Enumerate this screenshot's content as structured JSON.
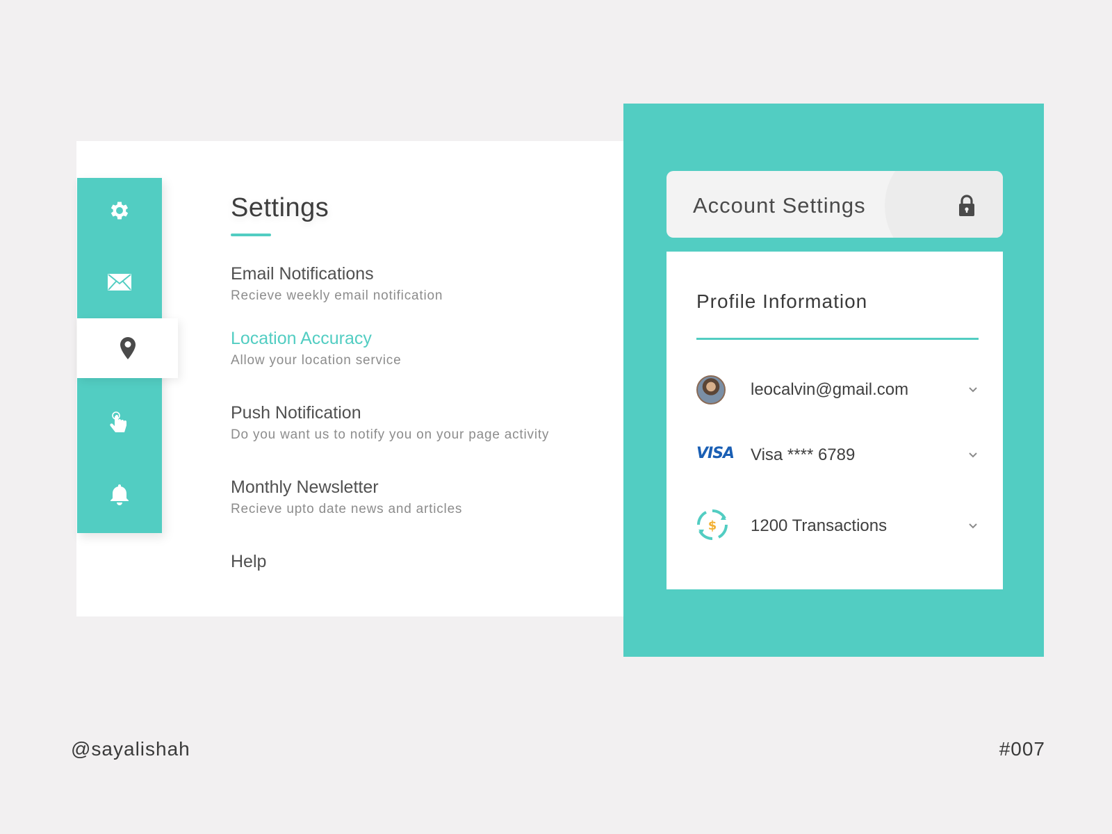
{
  "settings": {
    "title": "Settings",
    "items": [
      {
        "title": "Email Notifications",
        "subtitle": "Recieve weekly email notification"
      },
      {
        "title": "Location Accuracy",
        "subtitle": "Allow your location service"
      },
      {
        "title": "Push Notification",
        "subtitle": "Do you want us to notify you on your page activity"
      },
      {
        "title": "Monthly Newsletter",
        "subtitle": "Recieve upto date news and articles"
      },
      {
        "title": "Help"
      }
    ],
    "active_item": "Location Accuracy"
  },
  "icon_rail": {
    "items": [
      "gear-icon",
      "mail-icon",
      "location-pin-icon",
      "touch-icon",
      "bell-icon"
    ],
    "active": "location-pin-icon"
  },
  "account": {
    "title": "Account Settings",
    "profile_title": "Profile Information",
    "rows": [
      {
        "icon": "avatar",
        "text": "leocalvin@gmail.com"
      },
      {
        "icon": "visa-logo",
        "logo_text": "VISA",
        "text": "Visa **** 6789"
      },
      {
        "icon": "transactions-icon",
        "text": "1200 Transactions"
      }
    ]
  },
  "footer": {
    "handle": "@sayalishah",
    "tag": "#007"
  },
  "colors": {
    "accent": "#52cdc2",
    "background": "#f2f0f1",
    "card": "#ffffff",
    "visa_blue": "#1a5fb4",
    "coin_gold": "#f2b134"
  }
}
